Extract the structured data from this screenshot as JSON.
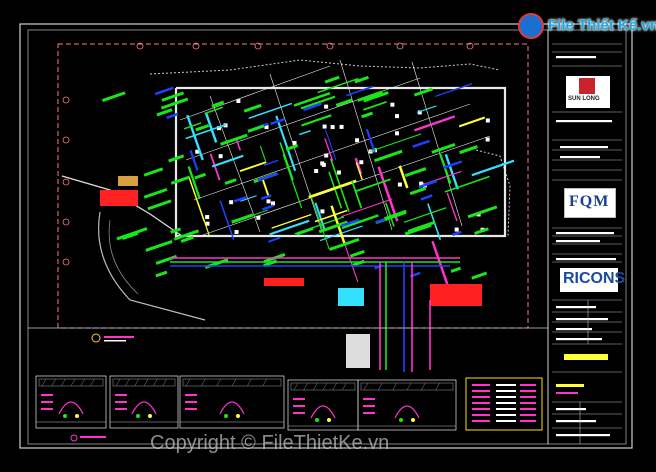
{
  "window": {
    "kind": "cad-drawing-preview",
    "background": "#000000"
  },
  "site_logo": {
    "text": "File Thiết Kế.vn",
    "color": "#17a8e6",
    "icon": "filethietke-badge-icon"
  },
  "title_block": {
    "client_logo_text": "SUN LONG",
    "contractor_logo_text": "FQM",
    "builder_logo_text": "RICONS"
  },
  "watermark": {
    "text": "Copyright © FileThietKe.vn"
  },
  "colors": {
    "pipe_green": "#19e619",
    "duct_blue": "#2040ff",
    "line_magenta": "#ff33cc",
    "wall_white": "#ffffff",
    "hatch_red": "#ff2020",
    "grid_pink": "#ff8080",
    "cyan": "#33e0ff",
    "yellow": "#ffff33"
  }
}
